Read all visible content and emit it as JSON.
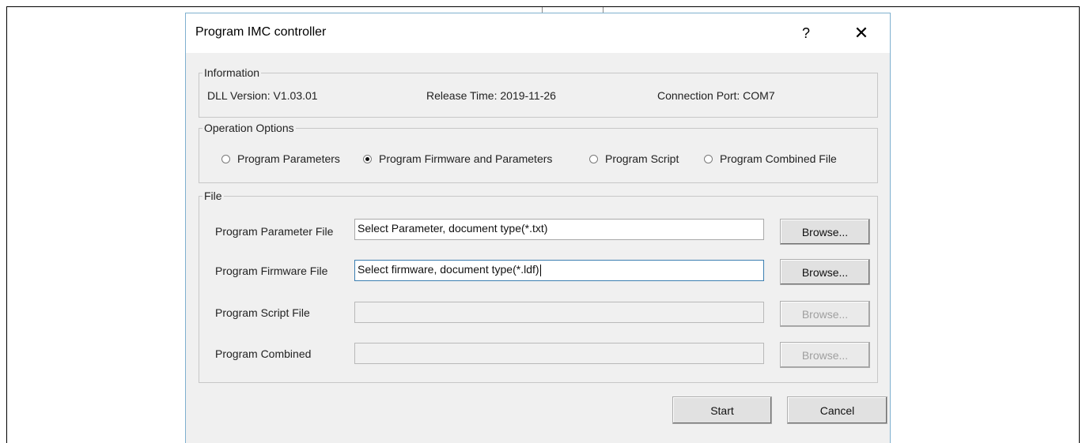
{
  "dialog": {
    "title": "Program  IMC controller",
    "help_label": "?",
    "close_label": "✕"
  },
  "information": {
    "legend": "Information",
    "dll_version": "DLL Version: V1.03.01",
    "release_time": "Release Time: 2019-11-26",
    "connection_port": "Connection Port: COM7"
  },
  "operation_options": {
    "legend": "Operation Options",
    "options": [
      {
        "label": "Program Parameters",
        "selected": false
      },
      {
        "label": "Program Firmware and Parameters",
        "selected": true
      },
      {
        "label": "Program Script",
        "selected": false
      },
      {
        "label": "Program Combined File",
        "selected": false
      }
    ]
  },
  "file": {
    "legend": "File",
    "rows": [
      {
        "label": "Program Parameter File",
        "value": "Select Parameter, document type(*.txt)",
        "enabled": true,
        "browse": "Browse..."
      },
      {
        "label": "Program Firmware File",
        "value": "Select firmware, document type(*.ldf)",
        "enabled": true,
        "browse": "Browse..."
      },
      {
        "label": "Program Script File",
        "value": "",
        "enabled": false,
        "browse": "Browse..."
      },
      {
        "label": "Program Combined",
        "value": "",
        "enabled": false,
        "browse": "Browse..."
      }
    ]
  },
  "actions": {
    "start": "Start",
    "cancel": "Cancel"
  }
}
